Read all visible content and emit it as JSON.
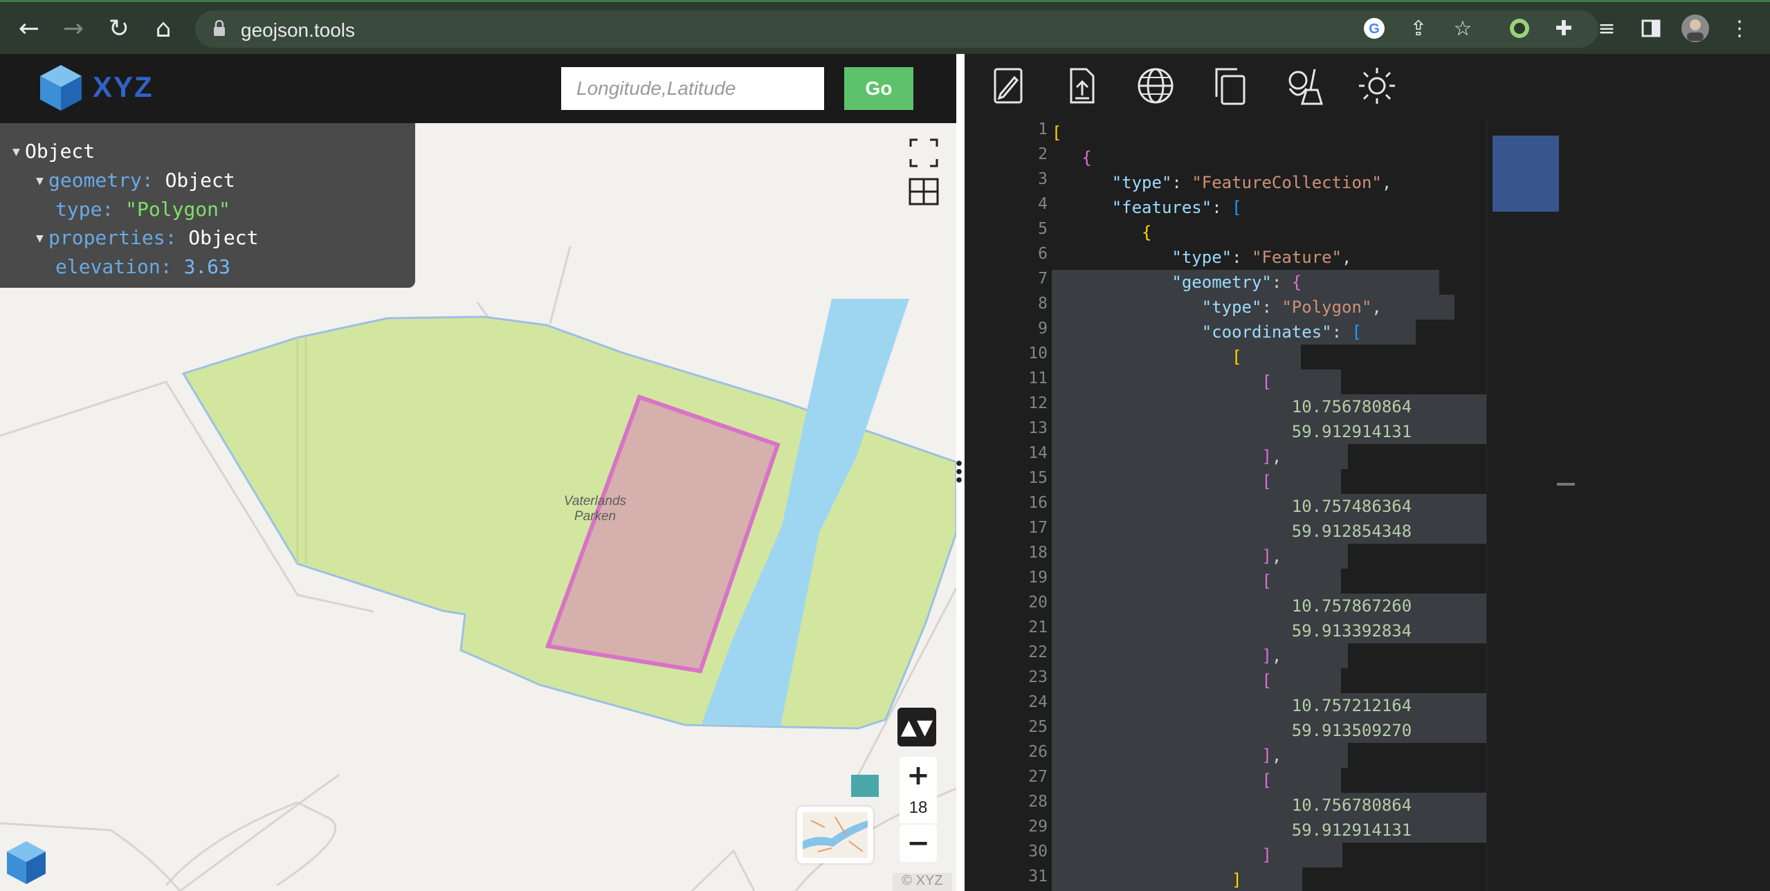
{
  "browser": {
    "url": "geojson.tools",
    "nav": {
      "back": "←",
      "forward": "→",
      "reload": "↻",
      "home": "⌂"
    },
    "right_icons": [
      "google-icon",
      "share-icon",
      "star-icon",
      "extension-leaf-icon",
      "puzzle-icon",
      "media-icon",
      "sidepanel-icon",
      "avatar",
      "menu-icon"
    ]
  },
  "map_header": {
    "logo_text": "XYZ",
    "coord_placeholder": "Longitude,Latitude",
    "go_label": "Go"
  },
  "inspector": {
    "root": "Object",
    "geometry_key": "geometry:",
    "geometry_val": "Object",
    "type_key": "type:",
    "type_val": "\"Polygon\"",
    "properties_key": "properties:",
    "properties_val": "Object",
    "elevation_key": "elevation:",
    "elevation_val": "3.63"
  },
  "map": {
    "place_label_1": "Vaterlands",
    "place_label_2": "Parken",
    "zoom": "18",
    "plus": "+",
    "minus": "−",
    "compass": "▲▼",
    "copyright": "© XYZ"
  },
  "editor": {
    "line_numbers": [
      "1",
      "2",
      "3",
      "4",
      "5",
      "6",
      "7",
      "8",
      "9",
      "10",
      "11",
      "12",
      "13",
      "14",
      "15",
      "16",
      "17",
      "18",
      "19",
      "20",
      "21",
      "22",
      "23",
      "24",
      "25",
      "26",
      "27",
      "28",
      "29",
      "30",
      "31"
    ]
  },
  "colors": {
    "accent_green": "#5dc26a",
    "park_fill": "#d3e6a0",
    "river_fill": "#9ed6f2",
    "polygon_fill": "#d7a8b8",
    "polygon_stroke": "#d873c7"
  }
}
